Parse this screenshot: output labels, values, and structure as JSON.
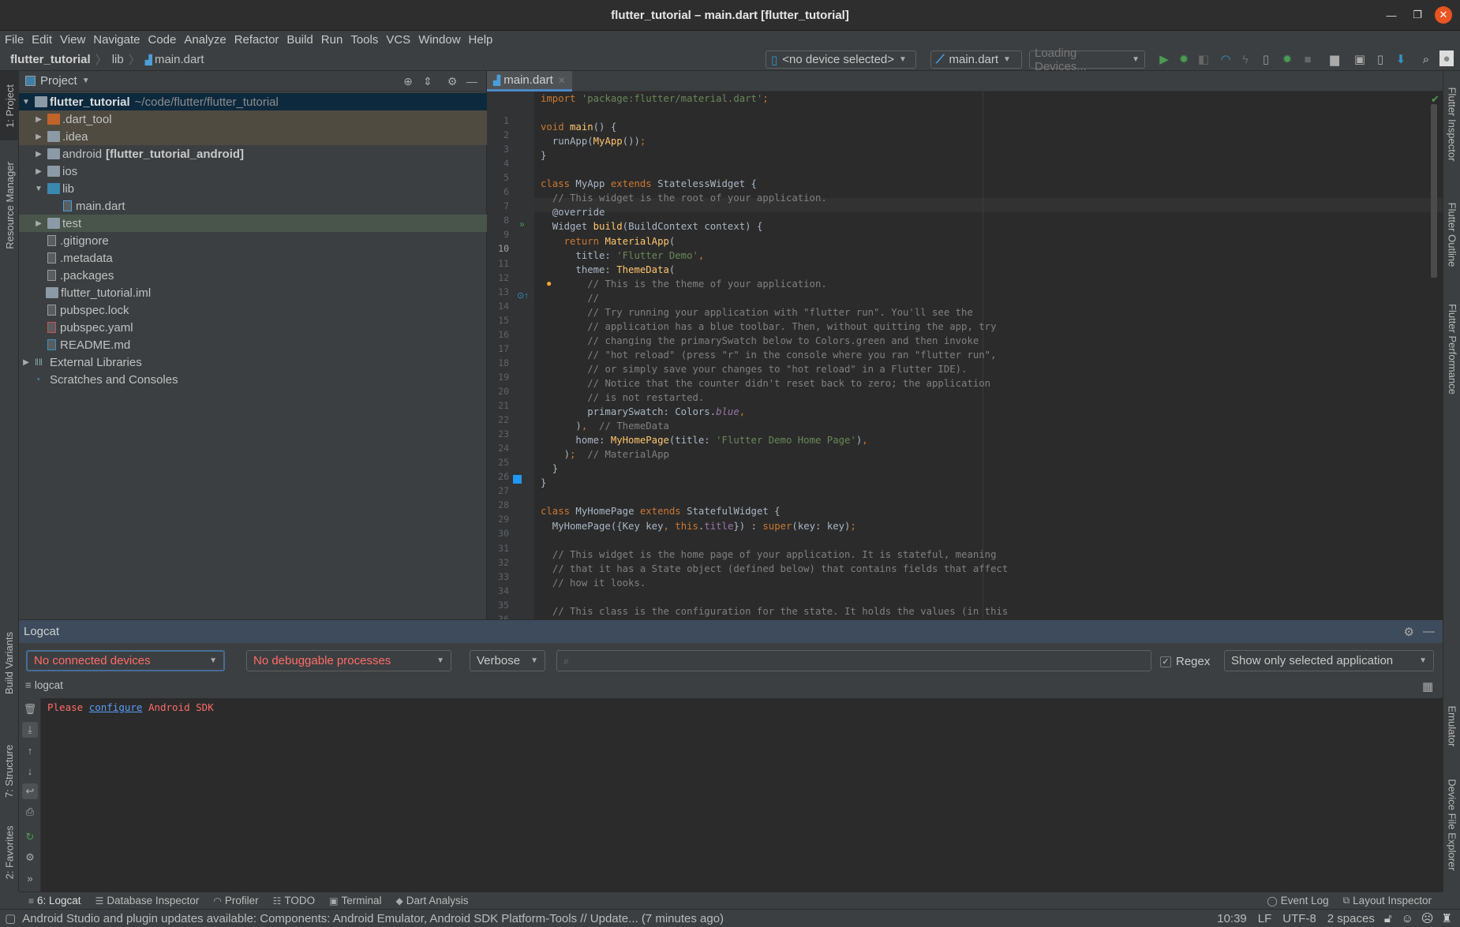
{
  "window": {
    "title": "flutter_tutorial – main.dart [flutter_tutorial]"
  },
  "menu": [
    "File",
    "Edit",
    "View",
    "Navigate",
    "Code",
    "Analyze",
    "Refactor",
    "Build",
    "Run",
    "Tools",
    "VCS",
    "Window",
    "Help"
  ],
  "breadcrumb": {
    "project": "flutter_tutorial",
    "folder": "lib",
    "file": "main.dart"
  },
  "toolbar": {
    "device_select": "<no device selected>",
    "run_config": "main.dart",
    "loading_devices": "Loading Devices..."
  },
  "left_strip": {
    "project": "1: Project",
    "resource_manager": "Resource Manager",
    "build_variants": "Build Variants",
    "structure": "7: Structure",
    "favorites": "2: Favorites"
  },
  "right_strip": {
    "flutter_inspector": "Flutter Inspector",
    "flutter_outline": "Flutter Outline",
    "flutter_performance": "Flutter Performance",
    "emulator": "Emulator",
    "device_file_explorer": "Device File Explorer"
  },
  "project_panel": {
    "title": "Project",
    "root": {
      "name": "flutter_tutorial",
      "path": "~/code/flutter/flutter_tutorial"
    },
    "items": [
      {
        "name": ".dart_tool",
        "suffix": ""
      },
      {
        "name": ".idea",
        "suffix": ""
      },
      {
        "name": "android",
        "suffix": "[flutter_tutorial_android]"
      },
      {
        "name": "ios",
        "suffix": ""
      },
      {
        "name": "lib",
        "suffix": ""
      },
      {
        "name": "main.dart",
        "suffix": ""
      },
      {
        "name": "test",
        "suffix": ""
      },
      {
        "name": ".gitignore",
        "suffix": ""
      },
      {
        "name": ".metadata",
        "suffix": ""
      },
      {
        "name": ".packages",
        "suffix": ""
      },
      {
        "name": "flutter_tutorial.iml",
        "suffix": ""
      },
      {
        "name": "pubspec.lock",
        "suffix": ""
      },
      {
        "name": "pubspec.yaml",
        "suffix": ""
      },
      {
        "name": "README.md",
        "suffix": ""
      },
      {
        "name": "External Libraries",
        "suffix": ""
      },
      {
        "name": "Scratches and Consoles",
        "suffix": ""
      }
    ]
  },
  "editor": {
    "tab": "main.dart",
    "lines": [
      "import 'package:flutter/material.dart';",
      "",
      "void main() {",
      "  runApp(MyApp());",
      "}",
      "",
      "class MyApp extends StatelessWidget {",
      "  // This widget is the root of your application.",
      "  @override",
      "  Widget build(BuildContext context) {",
      "    return MaterialApp(",
      "      title: 'Flutter Demo',",
      "      theme: ThemeData(",
      "        // This is the theme of your application.",
      "        //",
      "        // Try running your application with \"flutter run\". You'll see the",
      "        // application has a blue toolbar. Then, without quitting the app, try",
      "        // changing the primarySwatch below to Colors.green and then invoke",
      "        // \"hot reload\" (press \"r\" in the console where you ran \"flutter run\",",
      "        // or simply save your changes to \"hot reload\" in a Flutter IDE).",
      "        // Notice that the counter didn't reset back to zero; the application",
      "        // is not restarted.",
      "        primarySwatch: Colors.blue,",
      "      ),  // ThemeData",
      "      home: MyHomePage(title: 'Flutter Demo Home Page'),",
      "    );  // MaterialApp",
      "  }",
      "}",
      "",
      "class MyHomePage extends StatefulWidget {",
      "  MyHomePage({Key key, this.title}) : super(key: key);",
      "",
      "  // This widget is the home page of your application. It is stateful, meaning",
      "  // that it has a State object (defined below) that contains fields that affect",
      "  // how it looks.",
      "",
      "  // This class is the configuration for the state. It holds the values (in this"
    ]
  },
  "logcat": {
    "title": "Logcat",
    "device": "No connected devices",
    "process": "No debuggable processes",
    "level": "Verbose",
    "search_placeholder": "",
    "regex_label": "Regex",
    "regex_checked": true,
    "filter": "Show only selected application",
    "tab_label": "logcat",
    "message_prefix": "Please",
    "message_link": "configure",
    "message_suffix": "Android SDK"
  },
  "tool_windows": [
    "6: Logcat",
    "Database Inspector",
    "Profiler",
    "TODO",
    "Terminal",
    "Dart Analysis"
  ],
  "tool_windows_right": [
    "Event Log",
    "Layout Inspector"
  ],
  "status": {
    "message": "Android Studio and plugin updates available: Components: Android Emulator, Android SDK Platform-Tools // Update... (7 minutes ago)",
    "position": "10:39",
    "line_sep": "LF",
    "encoding": "UTF-8",
    "indent": "2 spaces"
  },
  "colors": {
    "accent": "#4a88c7",
    "error_text": "#ff6b68",
    "link": "#589df6",
    "run_green": "#499c54",
    "close_button": "#e95420"
  }
}
